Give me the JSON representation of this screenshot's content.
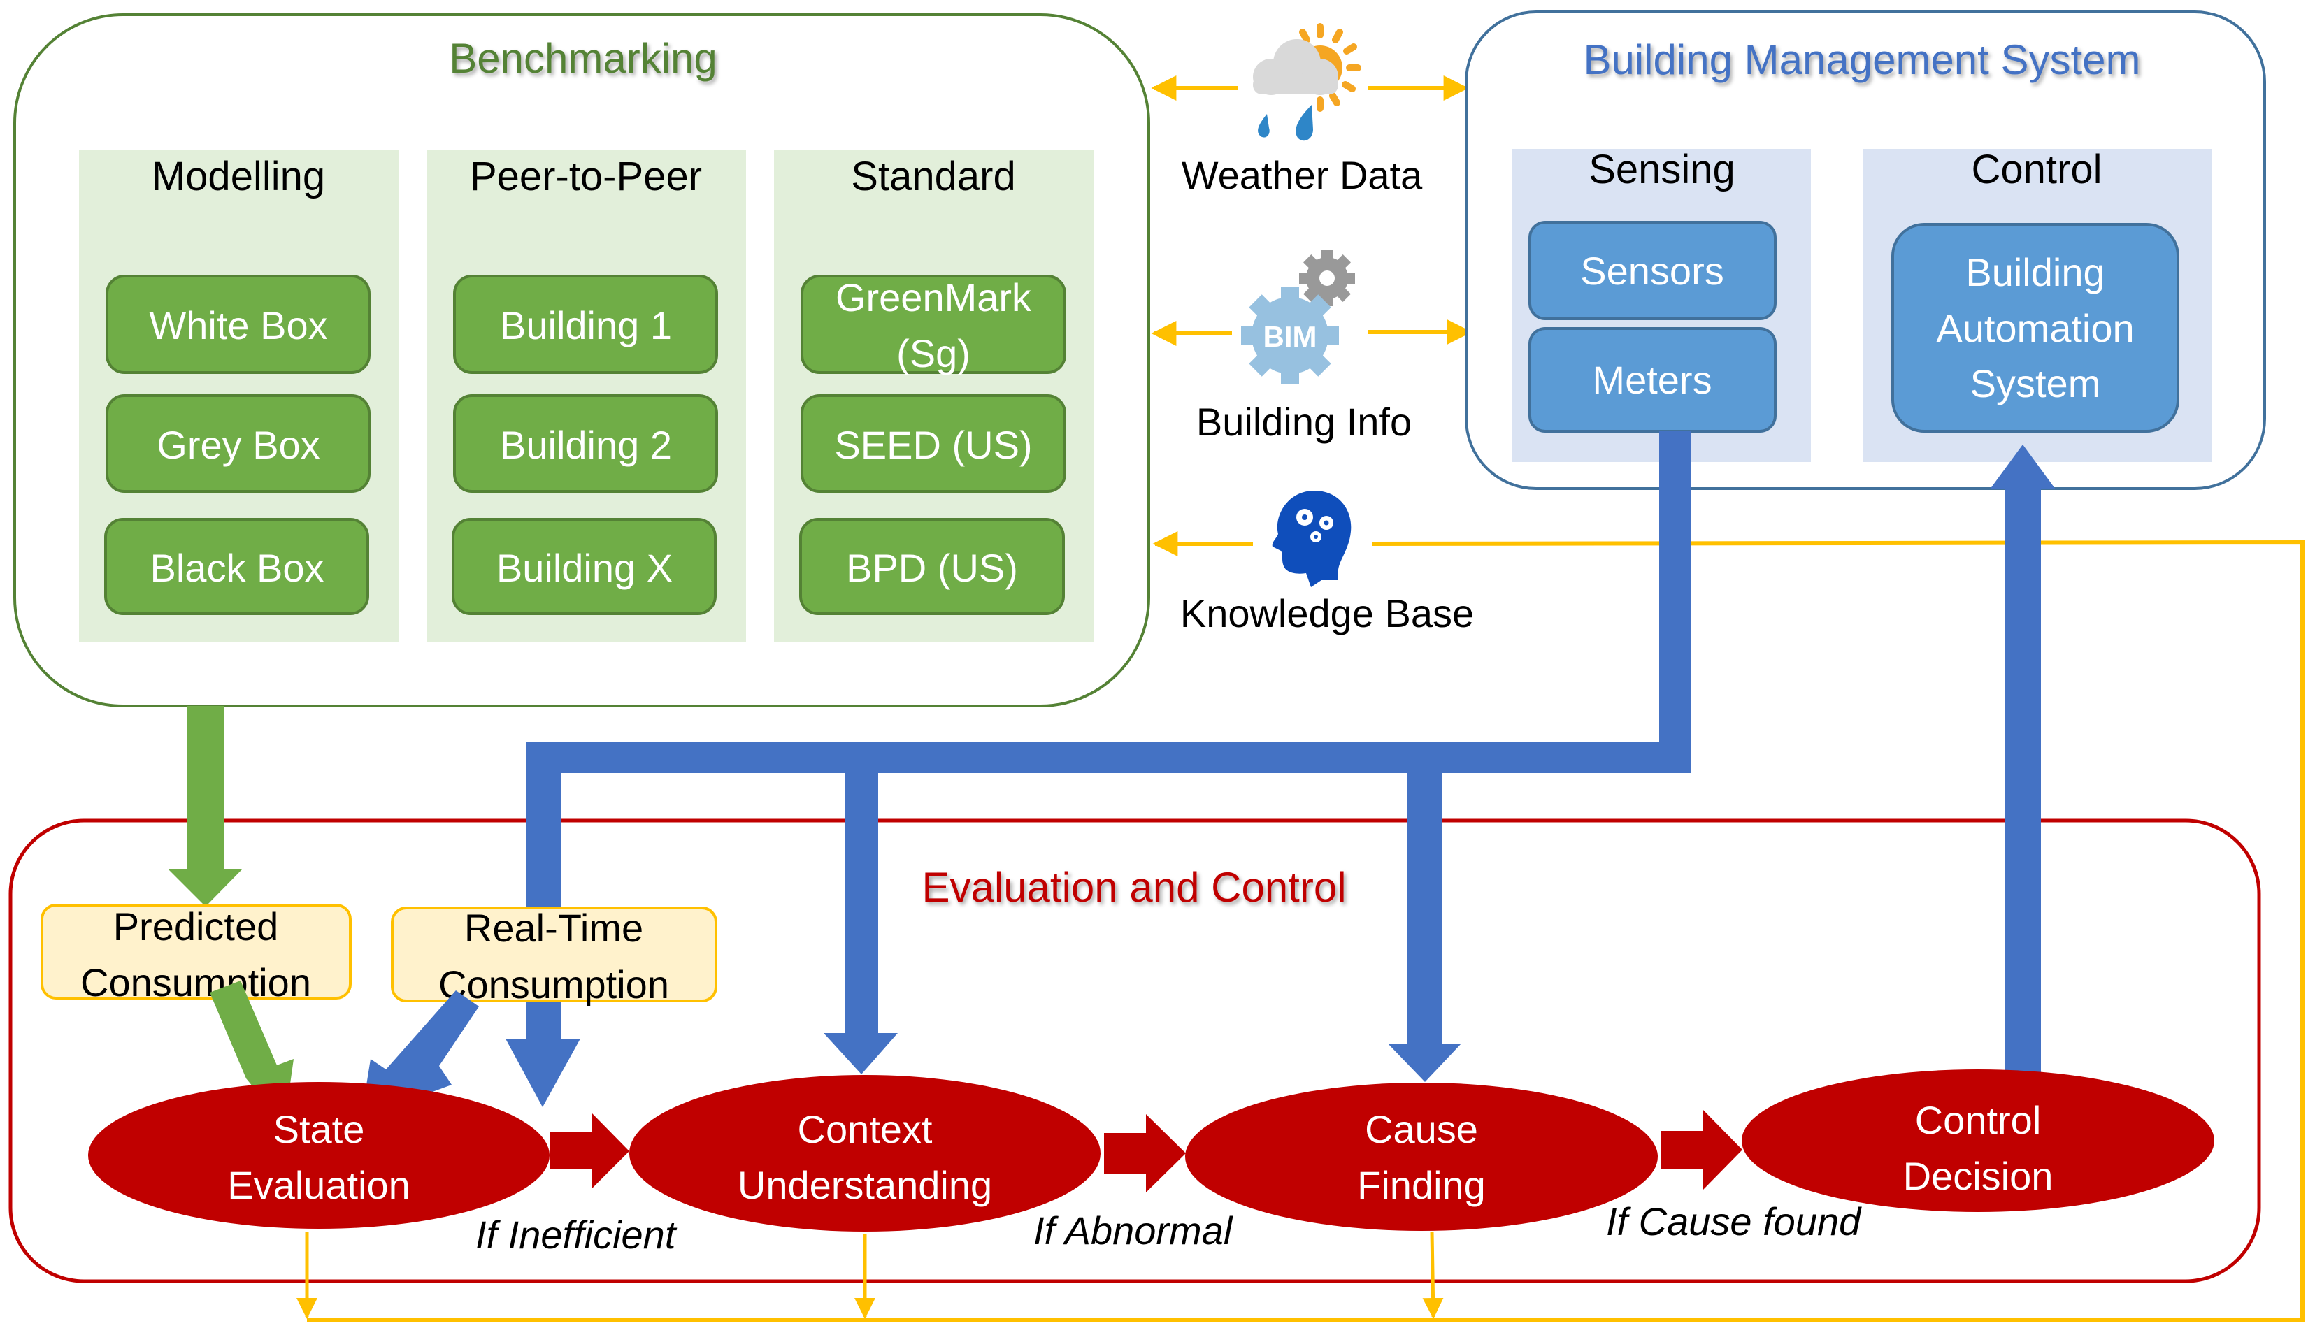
{
  "benchmarking": {
    "title": "Benchmarking",
    "columns": [
      {
        "title": "Modelling",
        "items": [
          "White Box",
          "Grey Box",
          "Black Box"
        ]
      },
      {
        "title": "Peer-to-Peer",
        "items": [
          "Building 1",
          "Building 2",
          "Building X"
        ]
      },
      {
        "title": "Standard",
        "items": [
          "GreenMark",
          "(Sg)",
          "SEED (US)",
          "BPD (US)"
        ]
      }
    ]
  },
  "sources": {
    "weather": {
      "label": "Weather Data",
      "icon": "weather-icon"
    },
    "bim": {
      "label": "Building Info",
      "icon": "bim-gear-icon",
      "badge": "BIM"
    },
    "knowledge": {
      "label": "Knowledge Base",
      "icon": "brain-gears-icon"
    }
  },
  "bms": {
    "title": "Building Management System",
    "sensing": {
      "title": "Sensing",
      "items": [
        "Sensors",
        "Meters"
      ]
    },
    "control": {
      "title": "Control",
      "item_lines": [
        "Building",
        "Automation",
        "System"
      ]
    }
  },
  "evaluation": {
    "title": "Evaluation and Control",
    "predicted": [
      "Predicted",
      "Consumption"
    ],
    "realtime": [
      "Real-Time",
      "Consumption"
    ],
    "stages": [
      {
        "lines": [
          "State",
          "Evaluation"
        ]
      },
      {
        "lines": [
          "Context",
          "Understanding"
        ]
      },
      {
        "lines": [
          "Cause",
          "Finding"
        ]
      },
      {
        "lines": [
          "Control",
          "Decision"
        ]
      }
    ],
    "conditions": [
      "If Inefficient",
      "If Abnormal",
      "If Cause found"
    ]
  },
  "colors": {
    "bench_green": "#548235",
    "btn_green": "#70AD47",
    "panel_green": "#E2EFDA",
    "bms_blue_border": "#41719C",
    "bms_title_blue": "#4472C4",
    "panel_blue": "#DAE3F3",
    "btn_blue": "#5B9BD5",
    "flow_blue": "#4472C4",
    "eval_red": "#C00000",
    "connector_yellow": "#FFC000",
    "cons_fill": "#FFF2CC"
  }
}
